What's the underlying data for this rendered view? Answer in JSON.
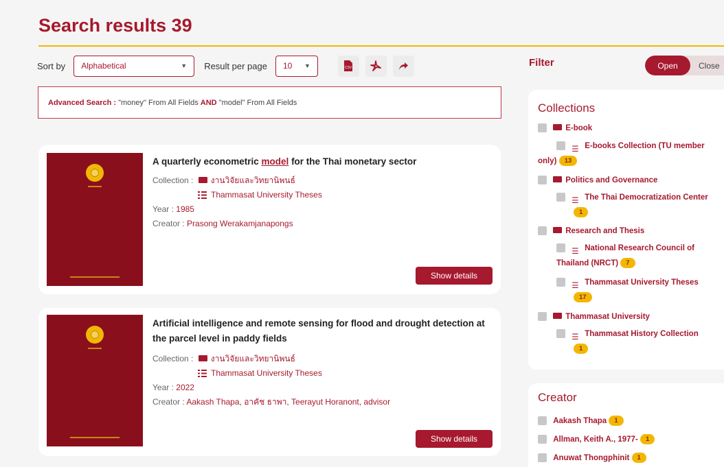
{
  "header": {
    "title": "Search results 39"
  },
  "toolbar": {
    "sort_label": "Sort by",
    "sort_value": "Alphabetical",
    "per_page_label": "Result per page",
    "per_page_value": "10",
    "export_buttons": [
      "csv-export-icon",
      "pdf-export-icon",
      "share-icon"
    ]
  },
  "advanced_search": {
    "label": "Advanced Search :",
    "term1": "\"money\" From All Fields",
    "operator": "AND",
    "term2": "\"model\" From All Fields"
  },
  "results": [
    {
      "title_before": "A quarterly econometric ",
      "title_highlight": "model",
      "title_after": " for the Thai monetary sector",
      "collection_label": "Collection :",
      "collection_main": "งานวิจัยและวิทยานิพนธ์",
      "collection_sub": "Thammasat University Theses",
      "year_label": "Year :",
      "year": "1985",
      "creator_label": "Creator :",
      "creator": "Prasong Werakamjanapongs",
      "button": "Show details"
    },
    {
      "title_line1": "Artificial intelligence and remote sensing for flood and drought detection at",
      "title_line2": "the parcel level in paddy fields",
      "collection_label": "Collection :",
      "collection_main": "งานวิจัยและวิทยานิพนธ์",
      "collection_sub": "Thammasat University Theses",
      "year_label": "Year :",
      "year": "2022",
      "creator_label": "Creator :",
      "creator": "Aakash Thapa, อาคัช ธาพา, Teerayut Horanont, advisor",
      "button": "Show details"
    }
  ],
  "filter": {
    "title": "Filter",
    "open_label": "Open",
    "close_label": "Close",
    "collections_title": "Collections",
    "collections": {
      "ebook": "E-book",
      "ebooks_collection_1": "E-books Collection (TU member",
      "ebooks_collection_2": "only)",
      "ebooks_collection_count": "13",
      "politics": "Politics and Governance",
      "thai_democratization": "The Thai Democratization Center",
      "thai_democratization_count": "1",
      "research": "Research and Thesis",
      "nrct_1": "National Research Council of",
      "nrct_2": "Thailand (NRCT)",
      "nrct_count": "7",
      "tu_theses": "Thammasat University Theses",
      "tu_theses_count": "17",
      "thammasat": "Thammasat University",
      "tu_history": "Thammasat History Collection",
      "tu_history_count": "1"
    },
    "creator_title": "Creator",
    "creators": [
      {
        "name": "Aakash Thapa",
        "count": "1"
      },
      {
        "name": "Allman, Keith A., 1977-",
        "count": "1"
      },
      {
        "name": "Anuwat Thongphinit",
        "count": "1"
      }
    ]
  },
  "colors": {
    "accent": "#a6192e",
    "highlight": "#f2b705",
    "background": "#f5f5f5"
  }
}
